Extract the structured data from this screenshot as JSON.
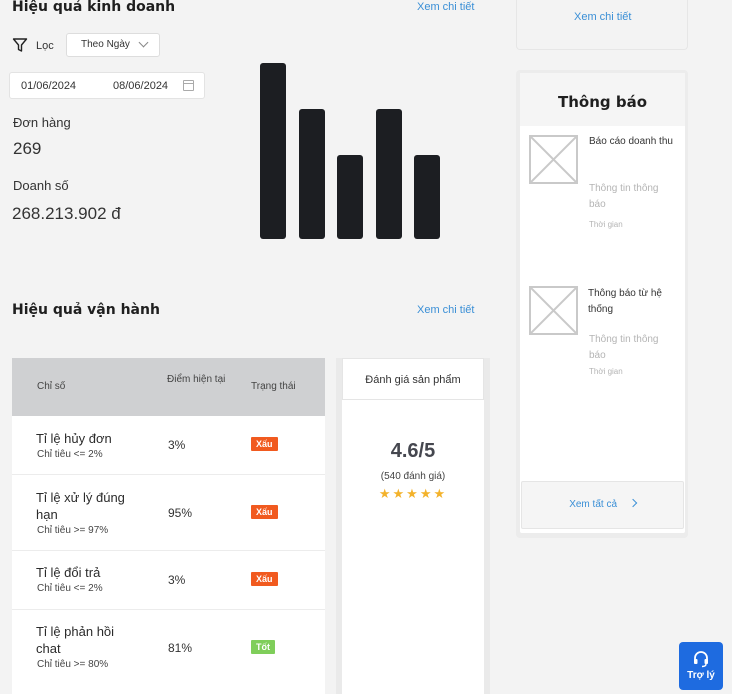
{
  "business": {
    "title": "Hiệu quả kinh doanh",
    "view_detail": "Xem chi tiết",
    "filter_label": "Lọc",
    "filter_select": "Theo Ngày",
    "date_from": "01/06/2024",
    "date_to": "08/06/2024",
    "orders_label": "Đơn hàng",
    "orders_value": "269",
    "revenue_label": "Doanh số",
    "revenue_value": "268.213.902 đ"
  },
  "chart_data": {
    "type": "bar",
    "categories": [
      "",
      "",
      "",
      "",
      ""
    ],
    "values": [
      100,
      74,
      48,
      74,
      48
    ],
    "title": "",
    "xlabel": "",
    "ylabel": "",
    "ylim": [
      0,
      100
    ],
    "color": "#1c1e22"
  },
  "operations": {
    "title": "Hiệu quả vận hành",
    "view_detail": "Xem chi tiết",
    "headers": [
      "Chỉ số",
      "Điểm hiện tại",
      "Trạng thái"
    ],
    "rows": [
      {
        "name": "Tỉ lệ hủy đơn",
        "target": "Chỉ tiêu <= 2%",
        "score": "3%",
        "status": "Xấu"
      },
      {
        "name": "Tỉ lệ xử lý đúng hạn",
        "target": "Chỉ tiêu >= 97%",
        "score": "95%",
        "status": "Xấu"
      },
      {
        "name": "Tỉ lệ đổi trả",
        "target": "Chỉ tiêu <= 2%",
        "score": "3%",
        "status": "Xấu"
      },
      {
        "name": "Tỉ lệ phản hồi chat",
        "target": "Chỉ tiêu >= 80%",
        "score": "81%",
        "status": "Tốt"
      }
    ],
    "colors": {
      "bad": "#f15a1f",
      "good": "#7fce5a"
    }
  },
  "rating": {
    "title": "Đánh giá sản phẩm",
    "score": "4.6/5",
    "count": "(540 đánh giá)",
    "stars": 5
  },
  "right": {
    "top_link": "Xem chi tiết",
    "notif_title": "Thông báo",
    "items": [
      {
        "title": "Báo cáo doanh thu",
        "info": "Thông tin thông báo",
        "time": "Thời gian"
      },
      {
        "title": "Thông báo từ hệ thống",
        "info": "Thông tin thông báo",
        "time": "Thời gian"
      }
    ],
    "view_all": "Xem tất cả"
  },
  "assistant": {
    "label": "Trợ lý",
    "icon": "headset-icon"
  }
}
